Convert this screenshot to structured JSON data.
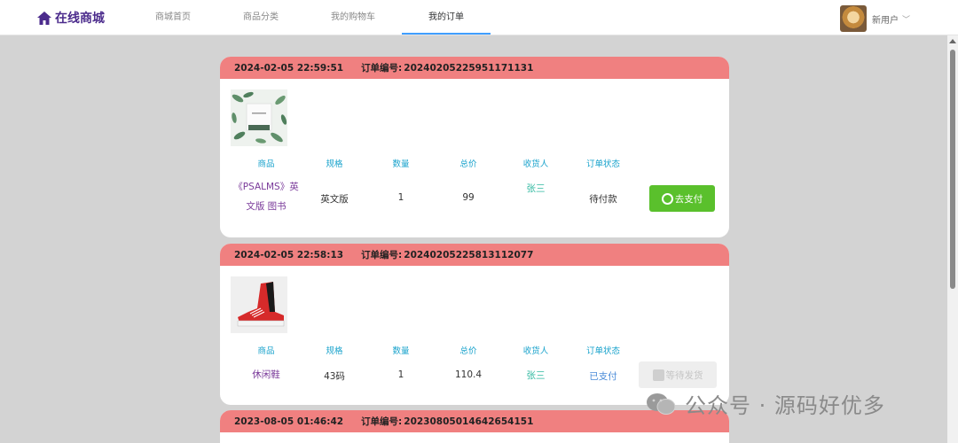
{
  "brand": {
    "name": "在线商城"
  },
  "nav": [
    {
      "label": "商城首页",
      "active": false
    },
    {
      "label": "商品分类",
      "active": false
    },
    {
      "label": "我的购物车",
      "active": false
    },
    {
      "label": "我的订单",
      "active": true
    }
  ],
  "user": {
    "name": "新用户"
  },
  "columns": [
    "商品",
    "规格",
    "数量",
    "总价",
    "收货人",
    "订单状态"
  ],
  "orders": [
    {
      "date": "2024-02-05 22:59:51",
      "no_label": "订单编号:",
      "no": "20240205225951171131",
      "product": "《PSALMS》英文版 图书",
      "product_line1": "《PSALMS》英",
      "product_line2": "文版 图书",
      "spec": "英文版",
      "qty": "1",
      "total": "99",
      "receiver": "张三",
      "status": "待付款",
      "action": "去支付"
    },
    {
      "date": "2024-02-05 22:58:13",
      "no_label": "订单编号:",
      "no": "20240205225813112077",
      "product": "休闲鞋",
      "spec": "43码",
      "qty": "1",
      "total": "110.4",
      "receiver": "张三",
      "status": "已支付",
      "action": "等待发货"
    },
    {
      "date": "2023-08-05 01:46:42",
      "no_label": "订单编号:",
      "no": "20230805014642654151"
    }
  ],
  "watermark": "公众号 · 源码好优多",
  "colors": {
    "header": "#f08080",
    "pay": "#5ac02c",
    "brand": "#4b2b8c"
  }
}
